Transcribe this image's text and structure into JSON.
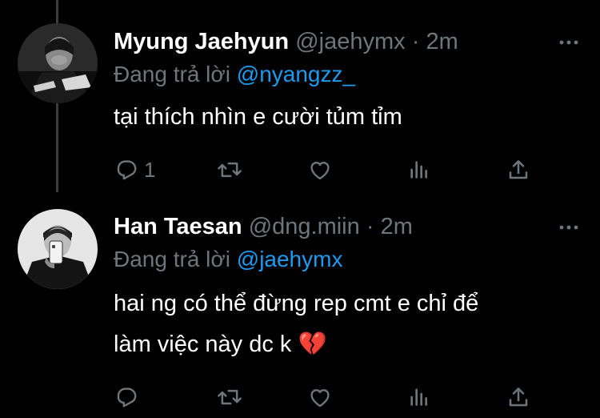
{
  "tweets": [
    {
      "display_name": "Myung Jaehyun",
      "handle": "@jaehymx",
      "separator": "·",
      "time": "2m",
      "reply_prefix": "Đang trả lời",
      "reply_to": "@nyangzz_",
      "text_lines": [
        "tại thích nhìn e cười tủm tỉm"
      ],
      "reply_count": "1",
      "avatar_icon": "profile-photo",
      "more_icon": "ellipsis-icon"
    },
    {
      "display_name": "Han Taesan",
      "handle": "@dng.miin",
      "separator": "·",
      "time": "2m",
      "reply_prefix": "Đang trả lời",
      "reply_to": "@jaehymx",
      "text_lines": [
        "hai ng có thể đừng rep cmt e chỉ để",
        "làm việc này dc k 💔"
      ],
      "reply_count": "",
      "avatar_icon": "profile-photo",
      "more_icon": "ellipsis-icon"
    }
  ],
  "colors": {
    "background": "#000000",
    "primary_text": "#ffffff",
    "secondary_text": "#6e767d",
    "mention": "#1d9bf0",
    "thread_line": "#3a3d41"
  },
  "action_icons": [
    "reply-icon",
    "retweet-icon",
    "like-icon",
    "views-icon",
    "share-icon"
  ]
}
